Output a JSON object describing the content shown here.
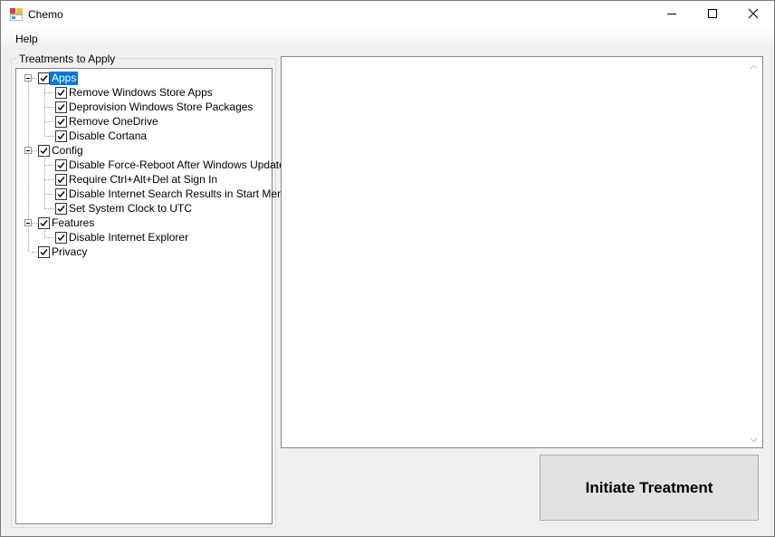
{
  "window": {
    "title": "Chemo",
    "icons": {
      "app": "app-window-icon",
      "minimize": "minimize-icon",
      "maximize": "maximize-icon",
      "close": "close-icon"
    }
  },
  "menu": {
    "items": [
      "Help"
    ]
  },
  "treatments": {
    "group_label": "Treatments to Apply",
    "tree": [
      {
        "label": "Apps",
        "checked": true,
        "selected": true,
        "expanded": true,
        "children": [
          {
            "label": "Remove Windows Store Apps",
            "checked": true
          },
          {
            "label": "Deprovision Windows Store Packages",
            "checked": true
          },
          {
            "label": "Remove OneDrive",
            "checked": true
          },
          {
            "label": "Disable Cortana",
            "checked": true
          }
        ]
      },
      {
        "label": "Config",
        "checked": true,
        "expanded": true,
        "children": [
          {
            "label": "Disable Force-Reboot After Windows Update",
            "checked": true
          },
          {
            "label": "Require Ctrl+Alt+Del at Sign In",
            "checked": true
          },
          {
            "label": "Disable Internet Search Results in Start Menu",
            "checked": true
          },
          {
            "label": "Set System Clock to UTC",
            "checked": true
          }
        ]
      },
      {
        "label": "Features",
        "checked": true,
        "expanded": true,
        "children": [
          {
            "label": "Disable Internet Explorer",
            "checked": true
          }
        ]
      },
      {
        "label": "Privacy",
        "checked": true,
        "expanded": false,
        "children": []
      }
    ]
  },
  "output": {
    "text": ""
  },
  "actions": {
    "initiate_label": "Initiate Treatment"
  }
}
